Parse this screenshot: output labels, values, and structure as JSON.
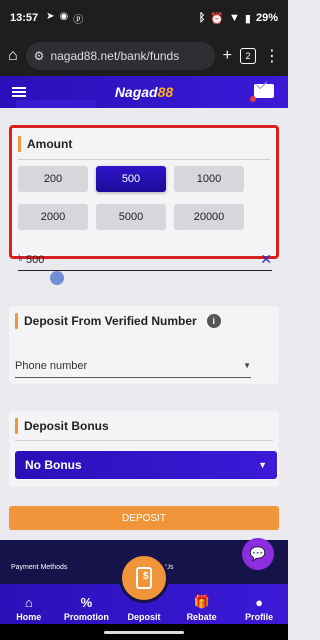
{
  "status": {
    "time": "13:57",
    "battery": "29%",
    "left_icons": [
      "navigation-icon",
      "telegram-icon",
      "pinterest-icon"
    ],
    "right_icons": [
      "bluetooth-icon",
      "alarm-icon",
      "wifi-icon",
      "battery-icon"
    ]
  },
  "browser": {
    "url": "nagad88.net/bank/funds",
    "tab_count": "2"
  },
  "header": {
    "logo_main": "Nagad",
    "logo_accent": "88"
  },
  "amount": {
    "title": "Amount",
    "options": [
      "200",
      "500",
      "1000",
      "2000",
      "5000",
      "20000"
    ],
    "selected": "500",
    "currency": "৳",
    "value": "500"
  },
  "verified": {
    "title": "Deposit From Verified Number",
    "phone_placeholder": "Phone number"
  },
  "bonus": {
    "title": "Deposit Bonus",
    "selected": "No Bonus"
  },
  "deposit_button": "DEPOSIT",
  "footer": {
    "payment_methods_label": "Payment Methods",
    "follow_label": "Us"
  },
  "nav": {
    "home": "Home",
    "promotion": "Promotion",
    "deposit": "Deposit",
    "rebate": "Rebate",
    "profile": "Profile"
  },
  "colors": {
    "brand": "#2a10b8",
    "accent": "#f0953a",
    "highlight_border": "#d8201f",
    "footer": "#16124a"
  }
}
